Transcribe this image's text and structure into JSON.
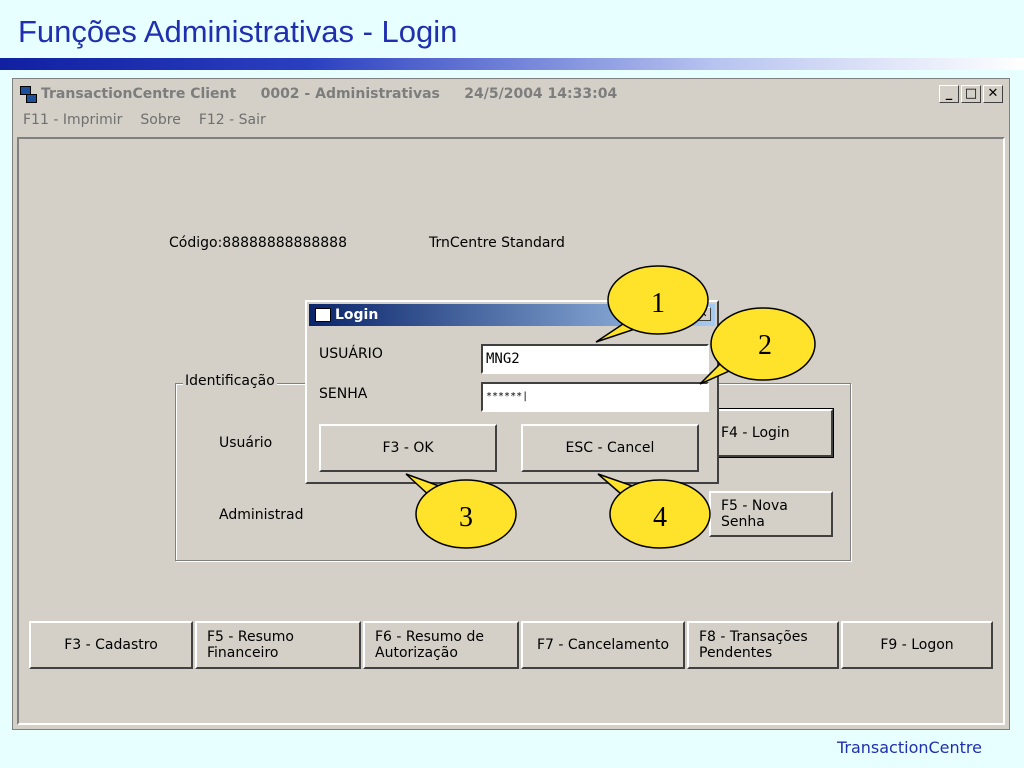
{
  "slide": {
    "title": "Funções Administrativas - Login",
    "footer": "TransactionCentre"
  },
  "window": {
    "title": "TransactionCentre Client     0002 - Administrativas     24/5/2004 14:33:04",
    "buttons": {
      "minimize": "_",
      "maximize": "□",
      "close": "✕"
    },
    "menu": [
      "F11 - Imprimir",
      "Sobre",
      "F12 - Sair"
    ]
  },
  "info": {
    "codigo": "Código:88888888888888",
    "product": "TrnCentre Standard"
  },
  "group": {
    "label": "Identificação",
    "usuario_label": "Usuário",
    "admin_label": "Administrad",
    "login_button": "F4 - Login",
    "nova_senha_button": "F5 - Nova Senha"
  },
  "dialog": {
    "title": "Login",
    "close": "✕",
    "usuario_label": "USUÁRIO",
    "usuario_value": "MNG2",
    "senha_label": "SENHA",
    "senha_value": "******|",
    "ok_button": "F3 - OK",
    "cancel_button": "ESC - Cancel"
  },
  "function_buttons": [
    "F3 - Cadastro",
    "F5 - Resumo Financeiro",
    "F6 - Resumo de Autorização",
    "F7 - Cancelamento",
    "F8 - Transações Pendentes",
    "F9 - Logon"
  ],
  "callouts": [
    "1",
    "2",
    "3",
    "4"
  ],
  "colors": {
    "slide_background": "#e8ffff",
    "title_color": "#1f2fb0",
    "window_face": "#d4d0c8",
    "callout_fill": "#ffe22a"
  }
}
